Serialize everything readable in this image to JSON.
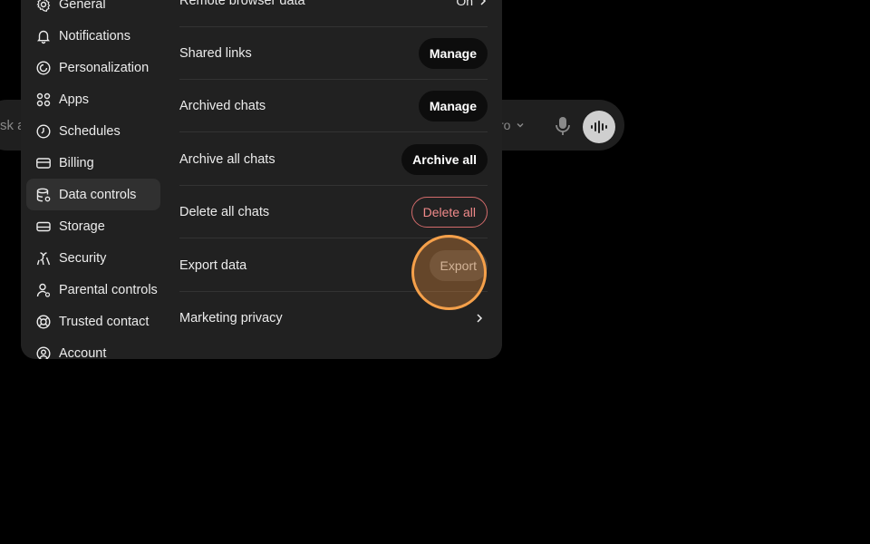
{
  "composer": {
    "placeholder": "sk a",
    "model_label": "ro"
  },
  "sidebar": {
    "items": [
      {
        "label": "General",
        "icon": "gear-icon"
      },
      {
        "label": "Notifications",
        "icon": "bell-icon"
      },
      {
        "label": "Personalization",
        "icon": "personalization-icon"
      },
      {
        "label": "Apps",
        "icon": "apps-grid-icon"
      },
      {
        "label": "Schedules",
        "icon": "clock-icon"
      },
      {
        "label": "Billing",
        "icon": "credit-card-icon"
      },
      {
        "label": "Data controls",
        "icon": "database-icon",
        "active": true
      },
      {
        "label": "Storage",
        "icon": "storage-icon"
      },
      {
        "label": "Security",
        "icon": "security-icon"
      },
      {
        "label": "Parental controls",
        "icon": "person-icon"
      },
      {
        "label": "Trusted contact",
        "icon": "lifebuoy-icon"
      },
      {
        "label": "Account",
        "icon": "account-icon"
      }
    ]
  },
  "settings": {
    "remote_browser": {
      "label": "Remote browser data",
      "value": "On"
    },
    "shared_links": {
      "label": "Shared links",
      "button": "Manage"
    },
    "archived_chats": {
      "label": "Archived chats",
      "button": "Manage"
    },
    "archive_all": {
      "label": "Archive all chats",
      "button": "Archive all"
    },
    "delete_all": {
      "label": "Delete all chats",
      "button": "Delete all"
    },
    "export_data": {
      "label": "Export data",
      "button": "Export"
    },
    "marketing": {
      "label": "Marketing privacy"
    }
  },
  "colors": {
    "background": "#000000",
    "modal": "#212121",
    "active_item": "#303030",
    "danger": "#f08a8a",
    "highlight": "#f5a04a"
  }
}
